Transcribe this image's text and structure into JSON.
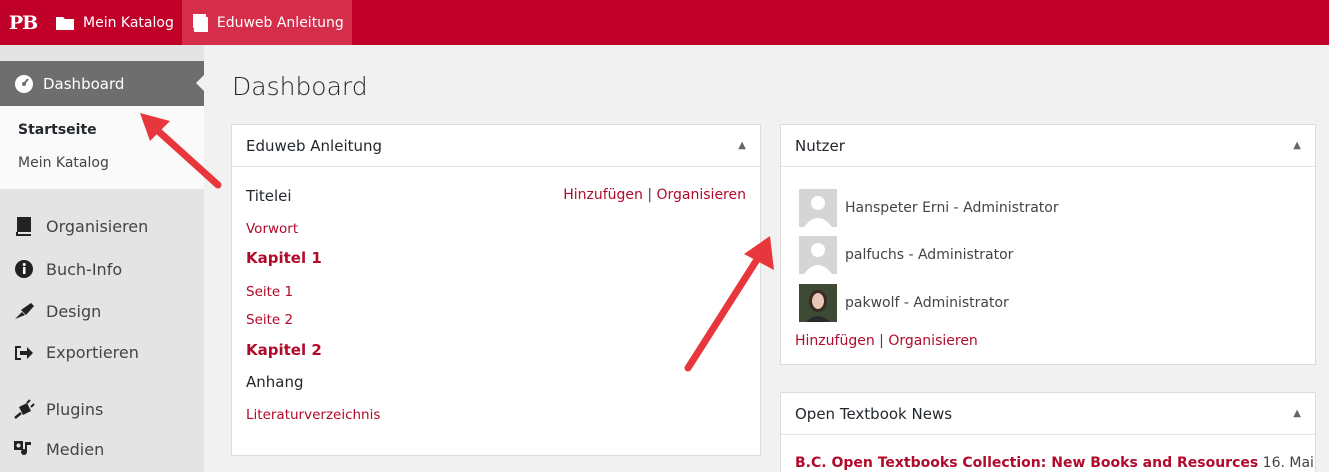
{
  "adminbar": {
    "logo": "PB",
    "catalog": "Mein Katalog",
    "book": "Eduweb Anleitung"
  },
  "sidebar": {
    "current": "Dashboard",
    "submenu": [
      "Startseite",
      "Mein Katalog"
    ],
    "items": [
      "Organisieren",
      "Buch-Info",
      "Design",
      "Exportieren",
      "Plugins",
      "Medien"
    ]
  },
  "page": {
    "title": "Dashboard"
  },
  "book_panel": {
    "title": "Eduweb Anleitung",
    "toggle": "▲",
    "front": "Titelei",
    "add": "Hinzufügen",
    "sep": "|",
    "organize": "Organisieren",
    "vorwort": "Vorwort",
    "chapter1": "Kapitel 1",
    "seite1": "Seite 1",
    "seite2": "Seite 2",
    "chapter2": "Kapitel 2",
    "back": "Anhang",
    "literatur": "Literaturverzeichnis"
  },
  "users_panel": {
    "title": "Nutzer",
    "toggle": "▲",
    "users": [
      "Hanspeter Erni - Administrator",
      "palfuchs - Administrator",
      "pakwolf - Administrator"
    ],
    "add": "Hinzufügen",
    "sep": "|",
    "organize": "Organisieren"
  },
  "news_panel": {
    "title": "Open Textbook News",
    "toggle": "▲",
    "headline": "B.C. Open Textbooks Collection: New Books and Resources",
    "date": "16. Mai"
  },
  "colors": {
    "brand": "#c1002a",
    "link": "#b10a2a",
    "arrow": "#e8373c"
  }
}
